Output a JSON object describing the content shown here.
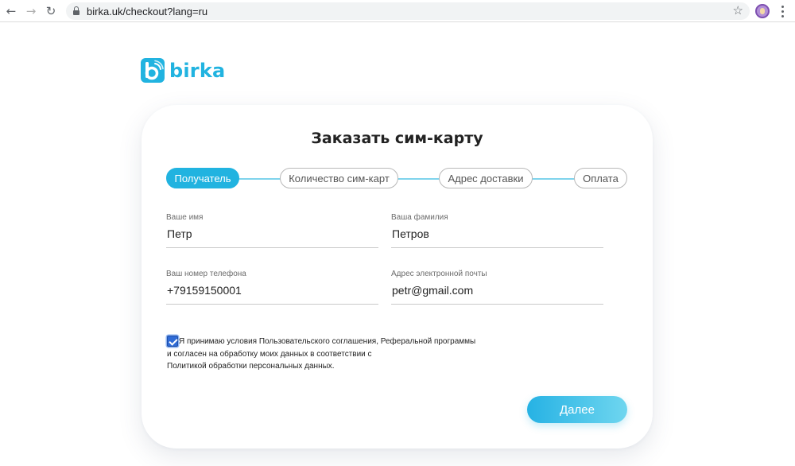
{
  "browser": {
    "url": "birka.uk/checkout?lang=ru",
    "icons": {
      "back": "arrow-left-icon",
      "forward": "arrow-right-icon",
      "reload": "reload-icon",
      "lock": "lock-icon",
      "bookmark": "star-icon",
      "profile": "avatar",
      "menu": "more-vertical-icon"
    }
  },
  "brand": {
    "name": "birka",
    "color": "#21b3e0"
  },
  "page": {
    "title": "Заказать сим-карту"
  },
  "steps": [
    {
      "label": "Получатель",
      "active": true
    },
    {
      "label": "Количество сим-карт",
      "active": false
    },
    {
      "label": "Адрес доставки",
      "active": false
    },
    {
      "label": "Оплата",
      "active": false
    }
  ],
  "form": {
    "first_name": {
      "label": "Ваше имя",
      "value": "Петр"
    },
    "last_name": {
      "label": "Ваша фамилия",
      "value": "Петров"
    },
    "phone": {
      "label": "Ваш номер телефона",
      "value": "+79159150001"
    },
    "email": {
      "label": "Адрес электронной почты",
      "value": "petr@gmail.com"
    },
    "consent": {
      "checked": true,
      "lines": [
        "Я принимаю условия Пользовательского соглашения, Реферальной программы",
        "и согласен на обработку моих данных в соответствии с",
        "Политикой обработки персональных данных."
      ]
    },
    "submit_label": "Далее"
  }
}
